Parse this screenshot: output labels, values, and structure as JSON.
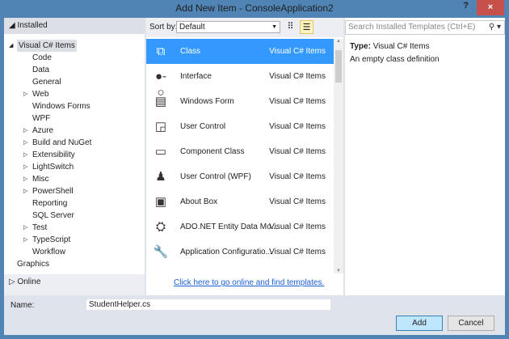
{
  "window": {
    "title": "Add New Item - ConsoleApplication2",
    "help": "?",
    "close": "×"
  },
  "left": {
    "header": "Installed",
    "online": "Online",
    "tree": [
      {
        "label": "Visual C# Items",
        "level": 0,
        "expander": "◢",
        "selected": true
      },
      {
        "label": "Code",
        "level": 1
      },
      {
        "label": "Data",
        "level": 1
      },
      {
        "label": "General",
        "level": 1
      },
      {
        "label": "Web",
        "level": 1,
        "expander": "▷"
      },
      {
        "label": "Windows Forms",
        "level": 1
      },
      {
        "label": "WPF",
        "level": 1
      },
      {
        "label": "Azure",
        "level": 1,
        "expander": "▷"
      },
      {
        "label": "Build and NuGet",
        "level": 1,
        "expander": "▷"
      },
      {
        "label": "Extensibility",
        "level": 1,
        "expander": "▷"
      },
      {
        "label": "LightSwitch",
        "level": 1,
        "expander": "▷"
      },
      {
        "label": "Misc",
        "level": 1,
        "expander": "▷"
      },
      {
        "label": "PowerShell",
        "level": 1,
        "expander": "▷"
      },
      {
        "label": "Reporting",
        "level": 1
      },
      {
        "label": "SQL Server",
        "level": 1
      },
      {
        "label": "Test",
        "level": 1,
        "expander": "▷"
      },
      {
        "label": "TypeScript",
        "level": 1,
        "expander": "▷"
      },
      {
        "label": "Workflow",
        "level": 1
      },
      {
        "label": "Graphics",
        "level": 0
      }
    ]
  },
  "sort": {
    "label": "Sort by:",
    "value": "Default"
  },
  "templates": [
    {
      "name": "Class",
      "category": "Visual C# Items",
      "icon": "class-icon",
      "glyph": "⧉",
      "selected": true
    },
    {
      "name": "Interface",
      "category": "Visual C# Items",
      "icon": "interface-icon",
      "glyph": "●-○"
    },
    {
      "name": "Windows Form",
      "category": "Visual C# Items",
      "icon": "windows-form-icon",
      "glyph": "▤"
    },
    {
      "name": "User Control",
      "category": "Visual C# Items",
      "icon": "user-control-icon",
      "glyph": "◲"
    },
    {
      "name": "Component Class",
      "category": "Visual C# Items",
      "icon": "component-class-icon",
      "glyph": "▭"
    },
    {
      "name": "User Control (WPF)",
      "category": "Visual C# Items",
      "icon": "user-control-wpf-icon",
      "glyph": "♟"
    },
    {
      "name": "About Box",
      "category": "Visual C# Items",
      "icon": "about-box-icon",
      "glyph": "▣"
    },
    {
      "name": "ADO.NET Entity Data Mo...",
      "category": "Visual C# Items",
      "icon": "entity-data-model-icon",
      "glyph": "⛭"
    },
    {
      "name": "Application Configuratio...",
      "category": "Visual C# Items",
      "icon": "app-config-icon",
      "glyph": "🔧"
    }
  ],
  "online_link": "Click here to go online and find templates.",
  "search": {
    "placeholder": "Search Installed Templates (Ctrl+E)"
  },
  "details": {
    "type_label": "Type:",
    "type_value": "Visual C# Items",
    "description": "An empty class definition"
  },
  "name": {
    "label": "Name:",
    "value": "StudentHelper.cs"
  },
  "buttons": {
    "add": "Add",
    "cancel": "Cancel"
  }
}
